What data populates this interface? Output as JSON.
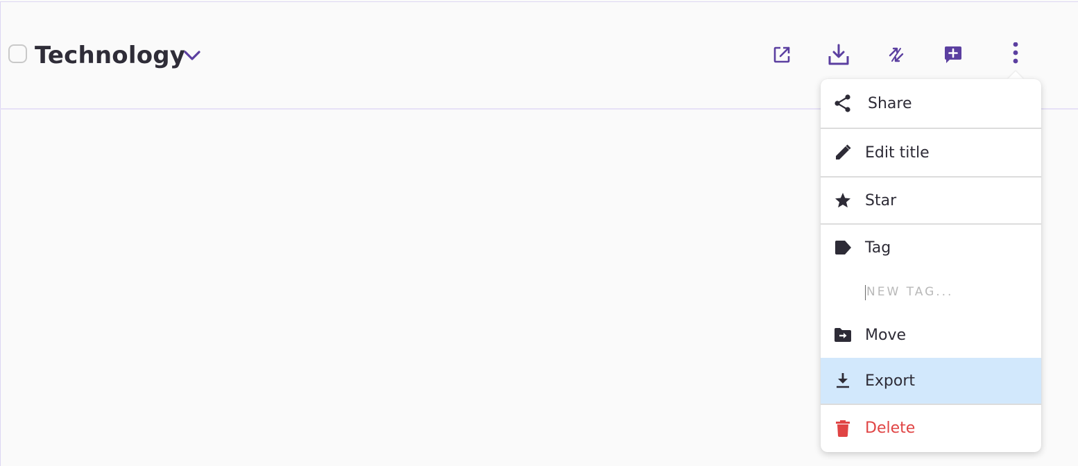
{
  "header": {
    "title": "Technology"
  },
  "toolbar": {
    "icons": [
      "open-external-icon",
      "download-icon",
      "sync-icon",
      "add-comment-icon",
      "more-vertical-icon"
    ]
  },
  "menu": {
    "items": [
      {
        "label": "Share",
        "icon": "share-icon"
      },
      {
        "label": "Edit title",
        "icon": "pencil-icon"
      },
      {
        "label": "Star",
        "icon": "star-icon"
      },
      {
        "label": "Tag",
        "icon": "tag-icon"
      },
      {
        "label": "Move",
        "icon": "folder-move-icon"
      },
      {
        "label": "Export",
        "icon": "export-download-icon"
      },
      {
        "label": "Delete",
        "icon": "trash-icon"
      }
    ],
    "tag_placeholder": "NEW TAG...",
    "highlighted_item": "Export"
  },
  "colors": {
    "accent": "#5b3fa0",
    "text": "#2d2b36",
    "highlight": "#d2e8fc",
    "danger": "#e04444",
    "background": "#fafafa"
  }
}
